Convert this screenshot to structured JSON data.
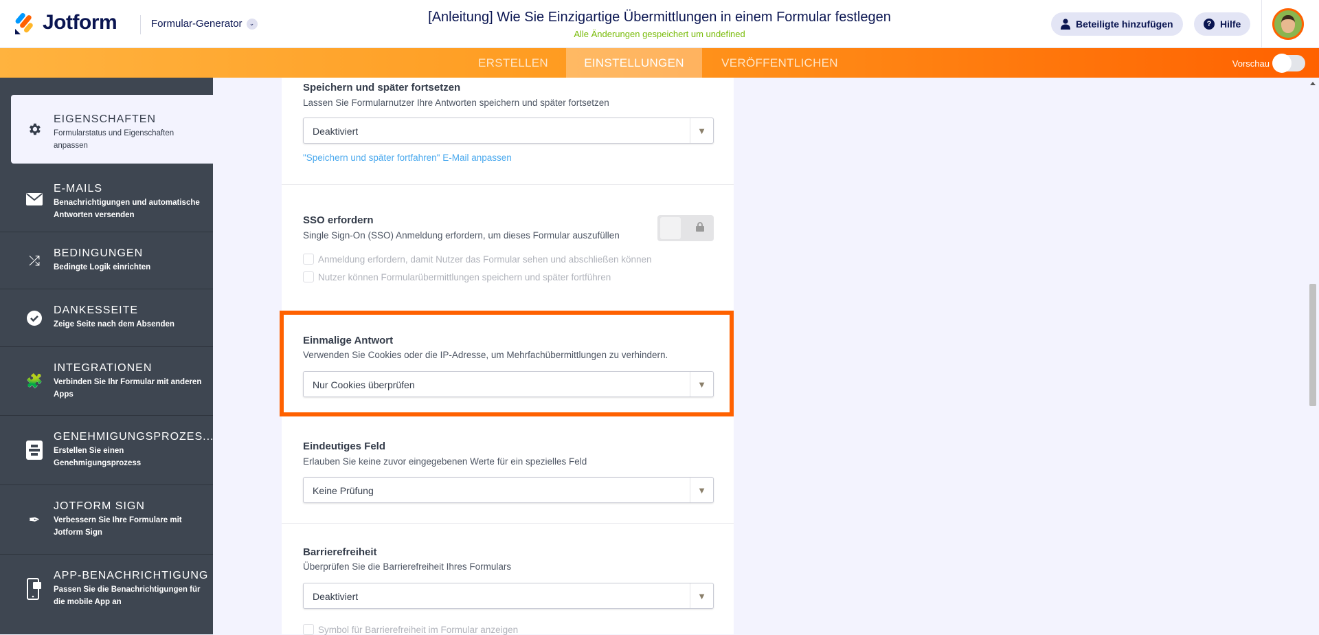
{
  "header": {
    "brand": "Jotform",
    "builder_label": "Formular-Generator",
    "form_title": "[Anleitung] Wie Sie Einzigartige Übermittlungen in einem Formular festlegen",
    "saved_status": "Alle Änderungen gespeichert um undefined",
    "add_participants": "Beteiligte hinzufügen",
    "help": "Hilfe"
  },
  "tabs": [
    {
      "label": "ERSTELLEN",
      "active": false
    },
    {
      "label": "EINSTELLUNGEN",
      "active": true
    },
    {
      "label": "VERÖFFENTLICHEN",
      "active": false
    }
  ],
  "preview": {
    "label": "Vorschau",
    "on": false
  },
  "sidebar": {
    "items": [
      {
        "title": "EIGENSCHAFTEN",
        "desc": "Formularstatus und Eigenschaften anpassen",
        "icon": "gear-icon",
        "active": true
      },
      {
        "title": "E-MAILS",
        "desc": "Benachrichtigungen und automatische Antworten versenden",
        "icon": "envelope-icon"
      },
      {
        "title": "BEDINGUNGEN",
        "desc": "Bedingte Logik einrichten",
        "icon": "shuffle-icon"
      },
      {
        "title": "DANKESSEITE",
        "desc": "Zeige Seite nach dem Absenden",
        "icon": "check-circle-icon"
      },
      {
        "title": "INTEGRATIONEN",
        "desc": "Verbinden Sie Ihr Formular mit anderen Apps",
        "icon": "puzzle-icon"
      },
      {
        "title": "GENEHMIGUNGSPROZES...",
        "desc": "Erstellen Sie einen Genehmigungsprozess",
        "icon": "flowchart-icon"
      },
      {
        "title": "JOTFORM SIGN",
        "desc": "Verbessern Sie Ihre Formulare mit Jotform Sign",
        "icon": "pen-icon"
      },
      {
        "title": "APP-BENACHRICHTIGUNG",
        "desc": "Passen Sie die Benachrichtigungen für die mobile App an",
        "icon": "mobile-icon"
      }
    ]
  },
  "settings": {
    "save_later": {
      "title": "Speichern und später fortsetzen",
      "desc": "Lassen Sie Formularnutzer Ihre Antworten speichern und später fortsetzen",
      "value": "Deaktiviert",
      "link": "\"Speichern und später fortfahren\" E-Mail anpassen"
    },
    "sso": {
      "title": "SSO erfordern",
      "desc": "Single Sign-On (SSO) Anmeldung erfordern, um dieses Formular auszufüllen",
      "enabled": false,
      "locked": true,
      "options": [
        {
          "label": "Anmeldung erfordern, damit Nutzer das Formular sehen und abschließen können",
          "checked": false
        },
        {
          "label": "Nutzer können Formularübermittlungen speichern und später fortführen",
          "checked": false
        }
      ]
    },
    "unique_submission": {
      "title": "Einmalige Antwort",
      "desc": "Verwenden Sie Cookies oder die IP-Adresse, um Mehrfachübermittlungen zu verhindern.",
      "value": "Nur Cookies überprüfen"
    },
    "unique_field": {
      "title": "Eindeutiges Feld",
      "desc": "Erlauben Sie keine zuvor eingegebenen Werte für ein spezielles Feld",
      "value": "Keine Prüfung"
    },
    "accessibility": {
      "title": "Barrierefreiheit",
      "desc": "Überprüfen Sie die Barrierefreiheit Ihres Formulars",
      "value": "Deaktiviert",
      "option": "Symbol für Barrierefreiheit im Formular anzeigen"
    }
  },
  "colors": {
    "accent": "#ff6100",
    "sidebar": "#3e4651",
    "link": "#4aa9ee",
    "saved": "#78bb07"
  }
}
